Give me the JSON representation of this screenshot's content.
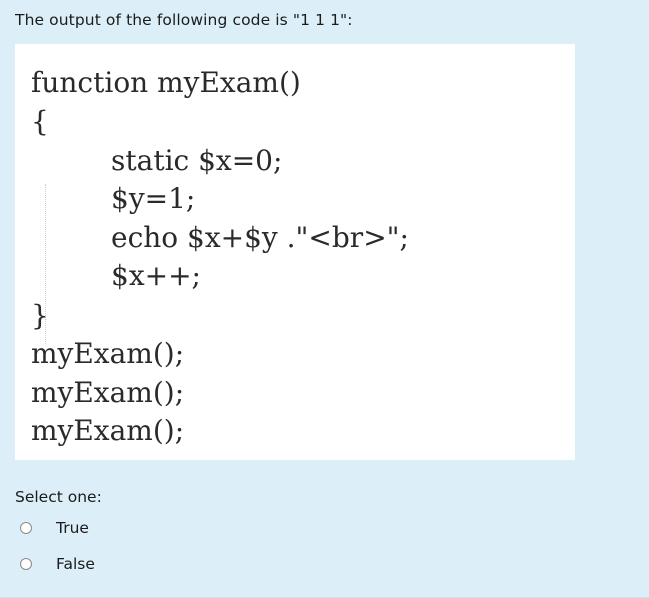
{
  "question": {
    "text": "The output of the following code is \"1 1 1\":"
  },
  "code": {
    "lines": [
      "function myExam()",
      "{",
      "static $x=0;",
      "$y=1;",
      "echo $x+$y .\"<br>\";",
      "$x++;",
      "}",
      "myExam();",
      "myExam();",
      "myExam();"
    ]
  },
  "answer": {
    "prompt": "Select one:",
    "options": [
      {
        "label": "True",
        "selected": false
      },
      {
        "label": "False",
        "selected": false
      }
    ]
  },
  "colors": {
    "panel_background": "#dceff8",
    "code_background": "#ffffff",
    "text": "#1b1b1b"
  }
}
